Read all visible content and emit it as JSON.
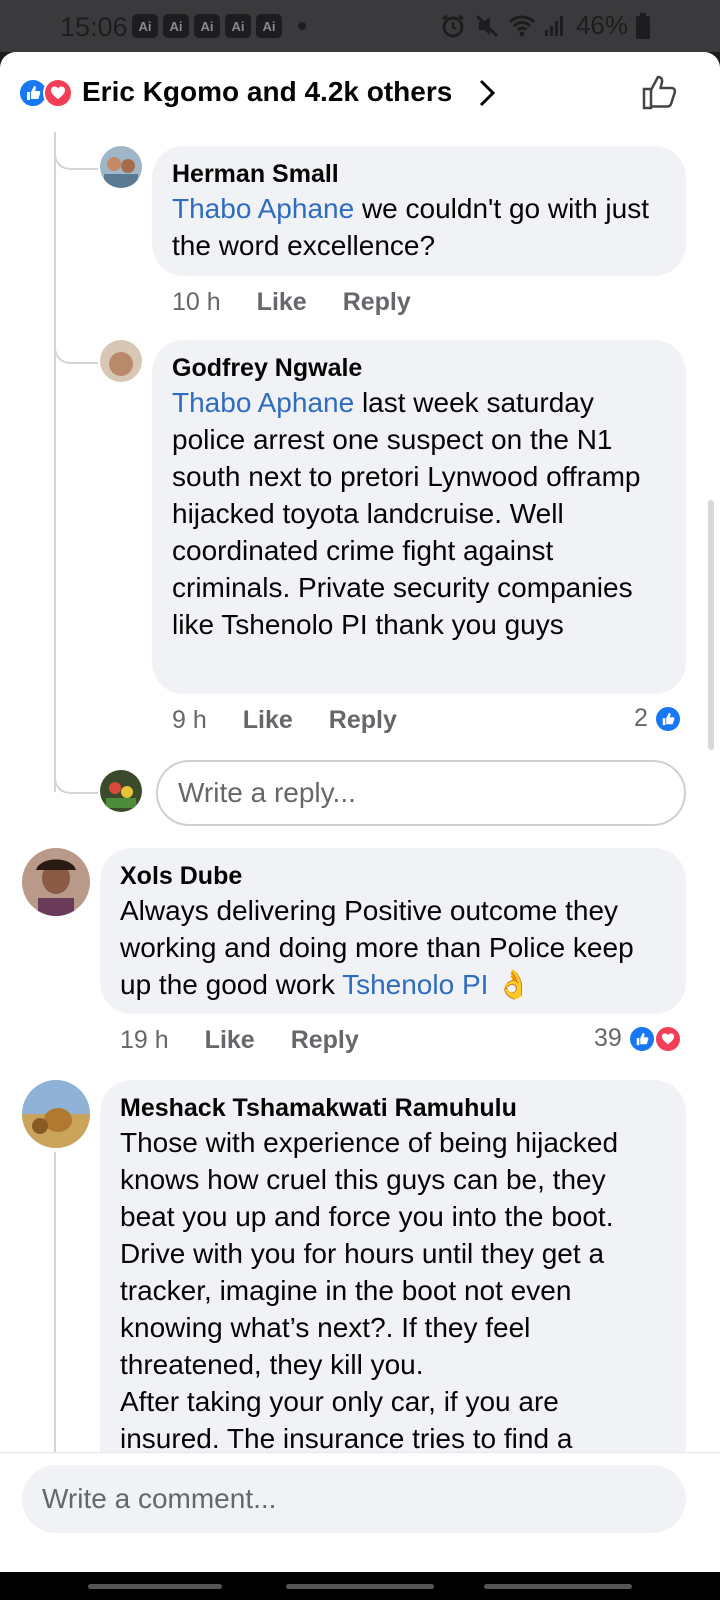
{
  "status_bar": {
    "time": "15:06",
    "notif_badges": [
      "Ai",
      "Ai",
      "Ai",
      "Ai",
      "Ai"
    ],
    "battery": "46%"
  },
  "header": {
    "reactors": "Eric Kgomo and 4.2k others"
  },
  "comments": [
    {
      "name": "Herman Small",
      "mention": "Thabo Aphane",
      "text": " we couldn't go with just the word excellence?",
      "time": "10 h",
      "like": "Like",
      "reply": "Reply"
    },
    {
      "name": "Godfrey Ngwale",
      "mention": "Thabo Aphane",
      "text": " last week saturday police arrest one suspect on the N1 south next to pretori Lynwood offramp hijacked toyota landcruise. Well coordinated crime fight against criminals. Private security companies like Tshenolo PI thank you guys",
      "time": "9 h",
      "like": "Like",
      "reply": "Reply",
      "reaction_count": "2"
    },
    {
      "name": "Xols Dube",
      "text_before": "Always delivering Positive outcome they working and doing more than Police keep up the good work ",
      "mention": "Tshenolo PI",
      "emoji": "👌",
      "time": "19 h",
      "like": "Like",
      "reply": "Reply",
      "reaction_count": "39"
    },
    {
      "name": "Meshack Tshamakwati Ramuhulu",
      "text": "Those with experience of being hijacked knows how cruel this guys can be, they beat you up and force you into the boot. Drive with you for hours until they get a tracker, imagine in the boot not even knowing what’s next?. If they feel threatened, they kill you.",
      "text2": "After taking your only car, if you are insured. The insurance tries to find a"
    }
  ],
  "reply_box": {
    "placeholder": "Write a reply..."
  },
  "comment_box": {
    "placeholder": "Write a comment..."
  },
  "colors": {
    "like_blue": "#1877f2",
    "love_red": "#f33e58",
    "mention_blue": "#2e6cbf",
    "bubble_bg": "#f0f2f5"
  }
}
